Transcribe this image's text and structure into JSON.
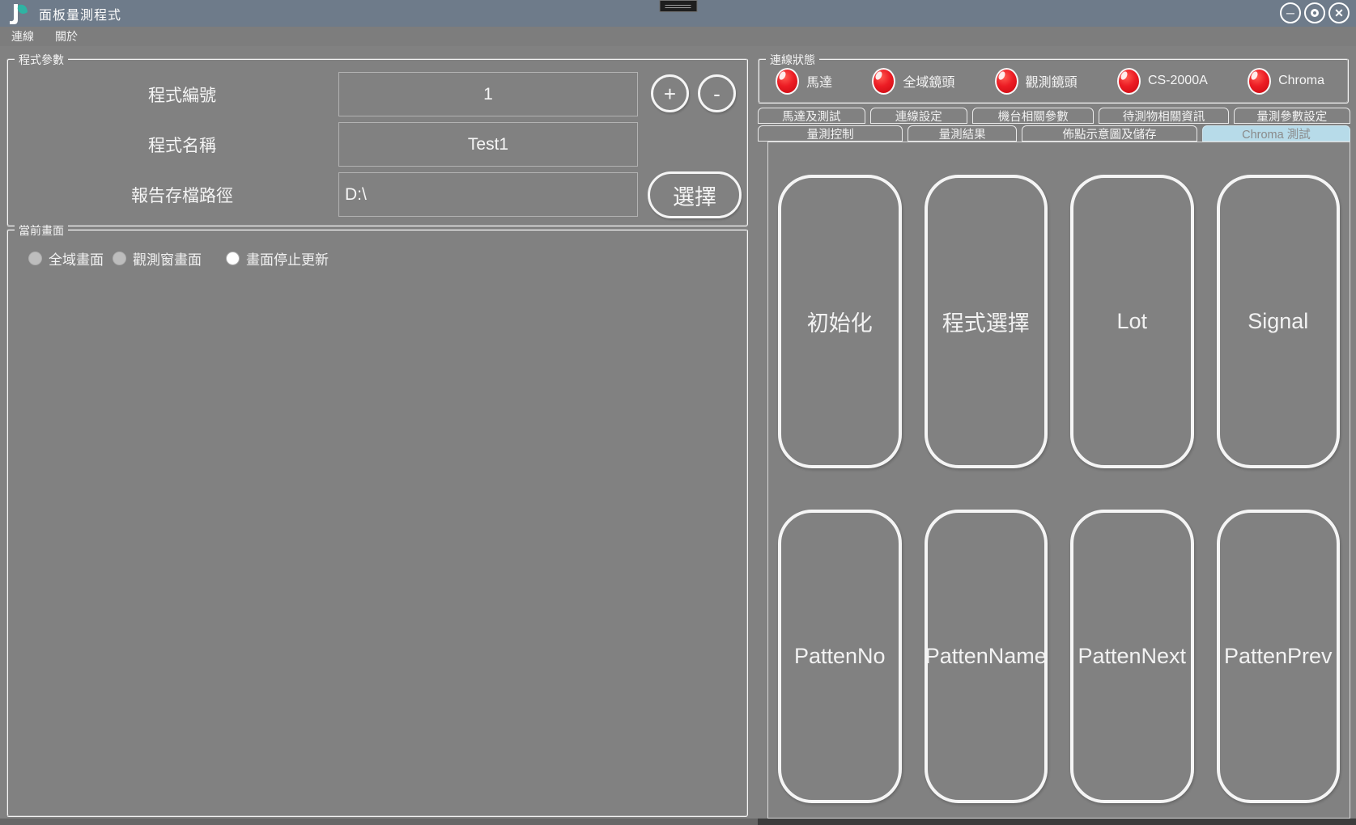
{
  "window": {
    "title": "面板量測程式",
    "controls": {
      "minimize_glyph": "─",
      "close_glyph": "✕"
    }
  },
  "menu": {
    "items": [
      "連線",
      "關於"
    ]
  },
  "program_params": {
    "title": "程式參數",
    "fields": [
      {
        "label": "程式編號",
        "value": "1"
      },
      {
        "label": "程式名稱",
        "value": "Test1"
      },
      {
        "label": "報告存檔路徑",
        "value": "D:\\"
      }
    ],
    "plus_label": "+",
    "minus_label": "-",
    "select_label": "選擇"
  },
  "current_screen": {
    "title": "當前畫面",
    "radios": [
      {
        "label": "全域畫面",
        "selected": false
      },
      {
        "label": "觀測窗畫面",
        "selected": false
      },
      {
        "label": "畫面停止更新",
        "selected": true
      }
    ]
  },
  "connection_status": {
    "title": "連線狀態",
    "led_color": "#ec1c24",
    "indicators": [
      {
        "label": "馬達"
      },
      {
        "label": "全域鏡頭"
      },
      {
        "label": "觀測鏡頭"
      },
      {
        "label": "CS-2000A"
      },
      {
        "label": "Chroma"
      }
    ]
  },
  "tabs": {
    "row1": [
      "馬達及測試",
      "連線設定",
      "機台相關參數",
      "待測物相關資訊",
      "量測參數設定"
    ],
    "row2": [
      {
        "label": "量測控制",
        "selected": false
      },
      {
        "label": "量測結果",
        "selected": false
      },
      {
        "label": "佈點示意圖及儲存",
        "selected": false
      },
      {
        "label": "Chroma 測試",
        "selected": true
      }
    ],
    "selected_bg": "#b7dbe9"
  },
  "chroma_page": {
    "buttons": [
      "初始化",
      "程式選擇",
      "Lot",
      "Signal",
      "PattenNo",
      "PattenName",
      "PattenNext",
      "PattenPrev"
    ]
  },
  "colors": {
    "titlebar": "#6e7b8a",
    "background": "#818181",
    "accent_teal": "#2fb3a3"
  }
}
